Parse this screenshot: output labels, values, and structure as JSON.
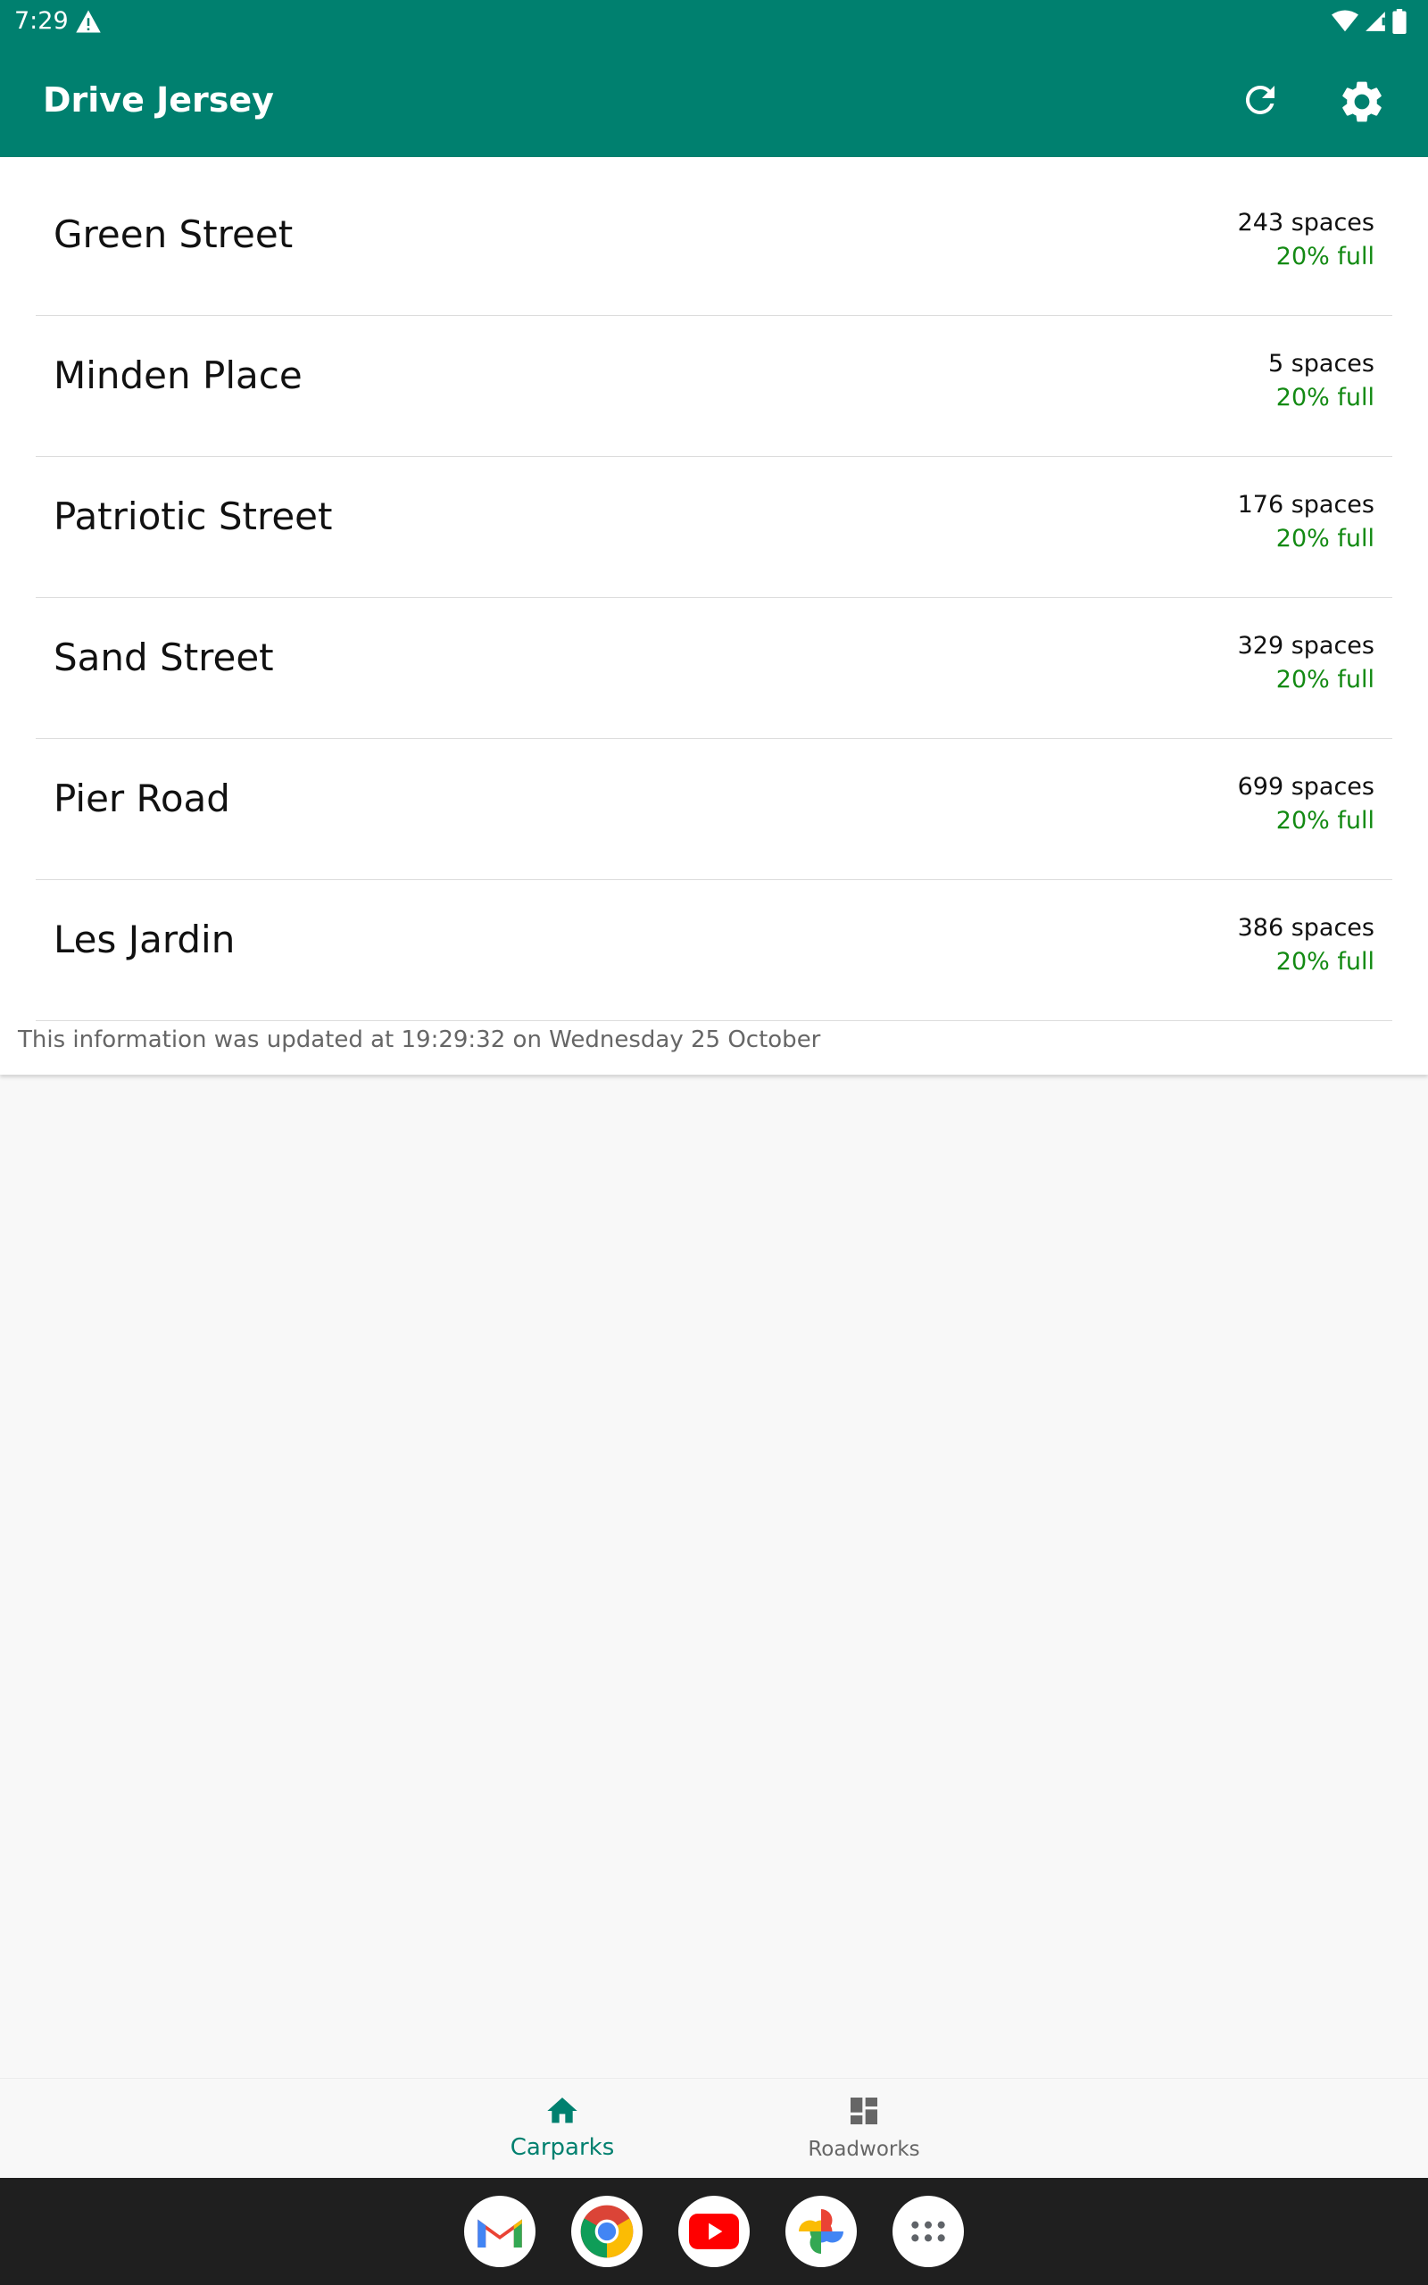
{
  "status_bar": {
    "time": "7:29"
  },
  "app_bar": {
    "title": "Drive Jersey"
  },
  "carparks": [
    {
      "name": "Green Street",
      "spaces": "243 spaces",
      "full": "20% full"
    },
    {
      "name": "Minden Place",
      "spaces": "5 spaces",
      "full": "20% full"
    },
    {
      "name": "Patriotic Street",
      "spaces": "176 spaces",
      "full": "20% full"
    },
    {
      "name": "Sand Street",
      "spaces": "329 spaces",
      "full": "20% full"
    },
    {
      "name": "Pier Road",
      "spaces": "699 spaces",
      "full": "20% full"
    },
    {
      "name": "Les Jardin",
      "spaces": "386 spaces",
      "full": "20% full"
    }
  ],
  "updated_text": "This information was updated at 19:29:32 on Wednesday 25 October",
  "bottom_nav": {
    "items": [
      {
        "label": "Carparks",
        "icon": "home-icon",
        "selected": true
      },
      {
        "label": "Roadworks",
        "icon": "dashboard-icon",
        "selected": false
      }
    ]
  },
  "dock": {
    "apps": [
      "gmail-icon",
      "chrome-icon",
      "youtube-icon",
      "photos-icon",
      "app-drawer-icon"
    ]
  },
  "colors": {
    "primary": "#00806f",
    "full_text": "#138a13"
  }
}
